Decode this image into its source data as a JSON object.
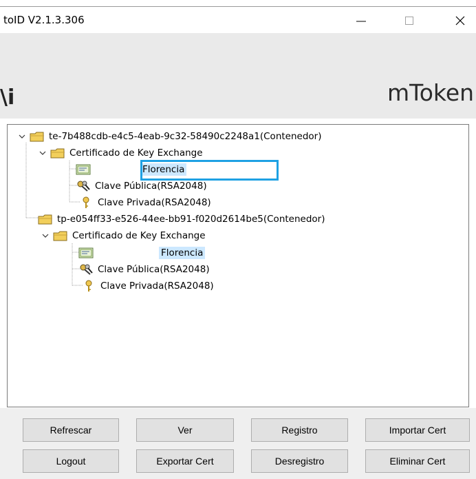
{
  "window": {
    "title": "toID  V2.1.3.306",
    "controls": {
      "minimize": "—",
      "maximize": "☐",
      "close": "✕"
    }
  },
  "banner": {
    "left_fragment": "\\i",
    "brand": "mToken"
  },
  "tree": {
    "container1": {
      "label": "te-7b488cdb-e4c5-4eab-9c32-58490c2248a1(Contenedor)",
      "icon": "folder-icon"
    },
    "cert1": {
      "label": "Certificado de Key Exchange",
      "icon": "folder-icon"
    },
    "cert1_item": {
      "label": "Florencia",
      "icon": "certificate-icon",
      "selected": true
    },
    "cert1_pub": {
      "label": "Clave Pública(RSA2048)",
      "icon": "keys-icon"
    },
    "cert1_priv": {
      "label": "Clave Privada(RSA2048)",
      "icon": "key-icon"
    },
    "container2": {
      "label": "tp-e054ff33-e526-44ee-bb91-f020d2614be5(Contenedor)",
      "icon": "folder-icon"
    },
    "cert2": {
      "label": "Certificado de Key Exchange",
      "icon": "folder-icon"
    },
    "cert2_item": {
      "label": "Florencia",
      "icon": "certificate-icon"
    },
    "cert2_pub": {
      "label": "Clave Pública(RSA2048)",
      "icon": "keys-icon"
    },
    "cert2_priv": {
      "label": "Clave Privada(RSA2048)",
      "icon": "key-icon"
    }
  },
  "buttons": {
    "refrescar": "Refrescar",
    "ver": "Ver",
    "registro": "Registro",
    "importar": "Importar Cert",
    "logout": "Logout",
    "exportar": "Exportar Cert",
    "desregistro": "Desregistro",
    "eliminar": "Eliminar  Cert"
  },
  "colors": {
    "highlight_box": "#1ea1e3",
    "selection_bg": "#cce8ff",
    "folder_yellow": "#f2cf5b",
    "banner_bg": "#eaeaea"
  }
}
